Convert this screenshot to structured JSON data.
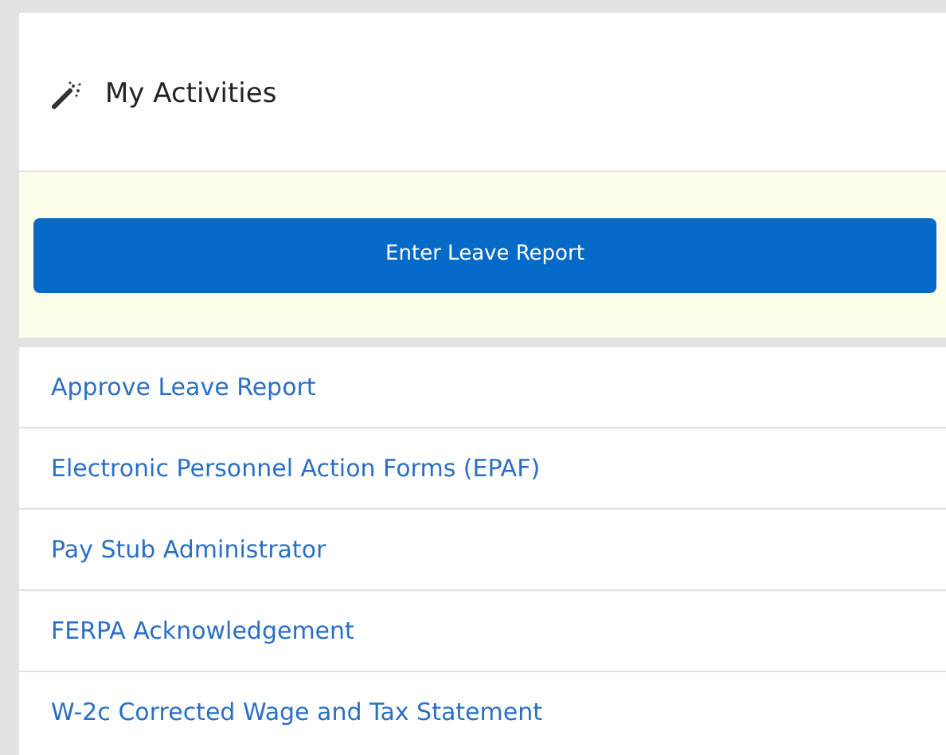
{
  "panel": {
    "title": "My Activities"
  },
  "primary_action": {
    "label": "Enter Leave Report"
  },
  "links": [
    {
      "label": "Approve Leave Report"
    },
    {
      "label": "Electronic Personnel Action Forms (EPAF)"
    },
    {
      "label": "Pay Stub Administrator"
    },
    {
      "label": "FERPA Acknowledgement"
    },
    {
      "label": "W-2c Corrected Wage and Tax Statement"
    }
  ]
}
